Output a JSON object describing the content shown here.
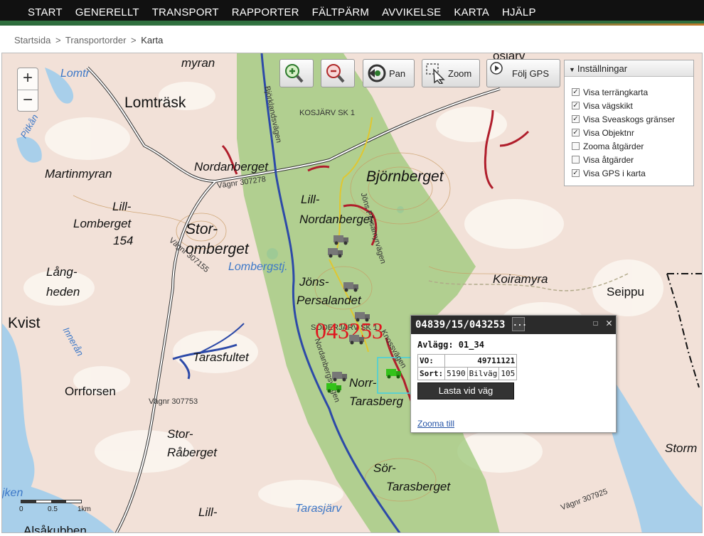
{
  "nav": {
    "items": [
      "START",
      "GENERELLT",
      "TRANSPORT",
      "RAPPORTER",
      "FÄLTPÄRM",
      "AVVIKELSE",
      "KARTA",
      "HJÄLP"
    ]
  },
  "breadcrumb": {
    "items": [
      "Startsida",
      "Transportorder"
    ],
    "separator": ">",
    "current": "Karta"
  },
  "map": {
    "zoom_in": "+",
    "zoom_out": "−",
    "toolbar": {
      "pan_label": "Pan",
      "zoom_label": "Zoom",
      "follow_gps_label": "Följ GPS"
    },
    "labels": {
      "myran": "myran",
      "lomtrask": "Lomträsk",
      "lomtr": "Lomtr",
      "pitkan": "Pitkån",
      "martinmyran": "Martinmyran",
      "nordanberget": "Nordanberget",
      "lill": "Lill-",
      "lomberget": "Lomberget",
      "n154": "154",
      "stor": "Stor-",
      "omberget": "omberget",
      "lombergstj": "Lombergstj.",
      "lang": "Lång-",
      "heden": "heden",
      "kvist": "Kvist",
      "innerån": "Innerån",
      "orrforsen": "Orrforsen",
      "tarasfultet": "Tarasfultet",
      "vagnr307753": "Vägnr 307753",
      "storraberget_a": "Stor-",
      "storraberget_b": "Råberget",
      "jken": "jken",
      "lill2": "Lill-",
      "alsakubben": "Alsåkubben",
      "bjornberget": "Björnberget",
      "lillnordanberget_a": "Lill-",
      "lillnordanberget_b": "Nordanberget",
      "jons_a": "Jöns-",
      "jons_b": "Persalandet",
      "norr": "Norr-",
      "tarasberg": "Tarasberg",
      "sor_a": "Sör-",
      "sor_b": "Tarasberget",
      "tarasjarv": "Tarasjärv",
      "koiramyran": "Koiramyra",
      "seippu": "Seippu",
      "storm": "Storm",
      "posjarv": "osjärv",
      "kosjarvsk1": "KOSJÄRV SK 1",
      "soderjarv": "SÖDERJÄRV SK 1",
      "vagnr307278": "Vägnr 307278",
      "vagnr30715": "Vägnr 307155",
      "bjorklandsvagen": "Björklandsvägen",
      "nordanbergsvagen": "Nordanbergsvägen",
      "jonsPersasvagen": "Jöns Persamyrvägen",
      "knos": "Knossvägen",
      "vagnr307925": "Vägnr 307925",
      "big_number": "043253",
      "lomtrask_small": "Lomtr",
      "svartbacken": "Vägnr 307753"
    },
    "scale": {
      "t0": "0",
      "t1": "0.5",
      "t2": "1km"
    }
  },
  "settings": {
    "title": "Inställningar",
    "items": [
      {
        "label": "Visa terrängkarta",
        "checked": "✓"
      },
      {
        "label": "Visa vägskikt",
        "checked": "✓"
      },
      {
        "label": "Visa Sveaskogs gränser",
        "checked": "✓"
      },
      {
        "label": "Visa Objektnr",
        "checked": "✓"
      },
      {
        "label": "Zooma åtgärder",
        "checked": ""
      },
      {
        "label": "Visa åtgärder",
        "checked": ""
      },
      {
        "label": "Visa GPS i karta",
        "checked": "✓"
      }
    ]
  },
  "popup": {
    "title": "04839/15/043253",
    "more": "...",
    "maximize": "☐",
    "close": "✕",
    "avlagg": "Avlägg: 01_34",
    "vo_label": "VO:",
    "vo_value": "49711121",
    "sort_label": "Sort:",
    "sort_code": "5190",
    "sort_name": "Bilväg",
    "sort_num": "105",
    "button": "Lasta vid väg",
    "link": "Zooma till"
  },
  "colors": {
    "nav_bg": "#111111",
    "forest": "#9bc878",
    "road_red": "#b01e2c",
    "road_blue": "#2d4aa8",
    "water": "#9cc8e8"
  }
}
